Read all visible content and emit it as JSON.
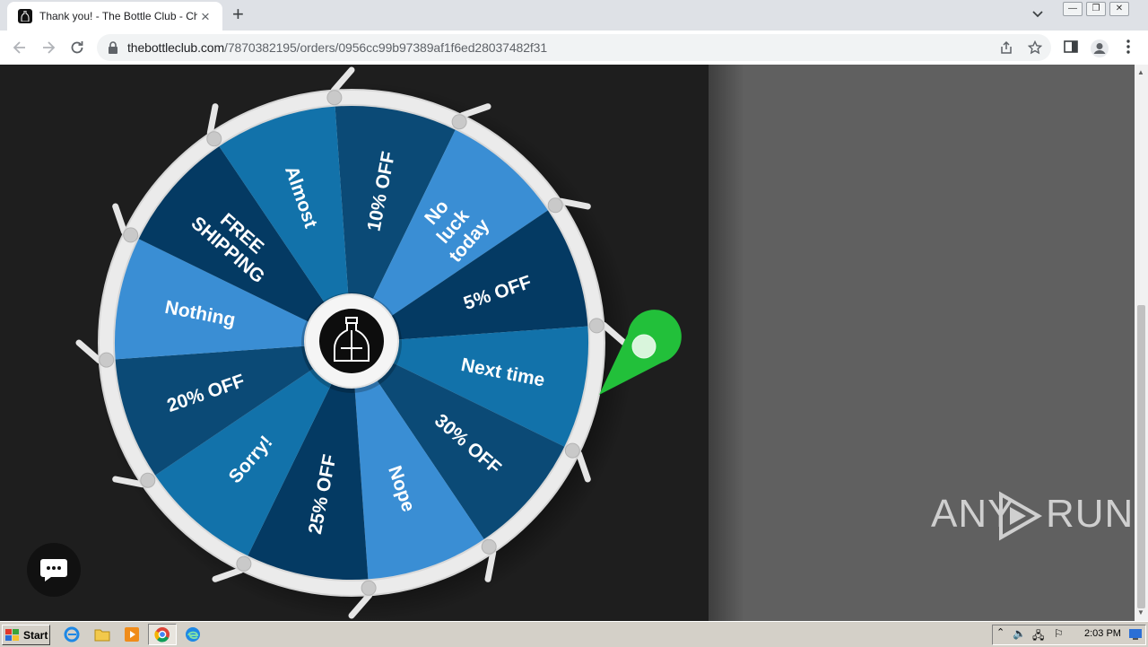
{
  "browser": {
    "tab_title": "Thank you! - The Bottle Club - Checkout",
    "url_host": "thebottleclub.com",
    "url_path": "/7870382195/orders/0956cc99b97389af1f6ed28037482f31"
  },
  "wheel": {
    "segments": [
      {
        "label": "10% OFF",
        "color": "#0b4a76"
      },
      {
        "label": "No luck today",
        "color": "#3a8ed4"
      },
      {
        "label": "5% OFF",
        "color": "#043a63"
      },
      {
        "label": "Next time",
        "color": "#1272aa"
      },
      {
        "label": "30% OFF",
        "color": "#0b4a76"
      },
      {
        "label": "Nope",
        "color": "#3a8ed4"
      },
      {
        "label": "25% OFF",
        "color": "#043a63"
      },
      {
        "label": "Sorry!",
        "color": "#1272aa"
      },
      {
        "label": "20% OFF",
        "color": "#0b4a76"
      },
      {
        "label": "Nothing",
        "color": "#3a8ed4"
      },
      {
        "label": "FREE SHIPPING",
        "color": "#043a63"
      },
      {
        "label": "Almost",
        "color": "#1272aa"
      }
    ],
    "pointer_color": "#22c03a",
    "rim_color": "#ebebeb"
  },
  "widgets": {
    "chat_icon": "chat-bubble-icon"
  },
  "watermark": {
    "left": "ANY",
    "right": "RUN"
  },
  "taskbar": {
    "start_label": "Start",
    "clock": "2:03 PM"
  }
}
